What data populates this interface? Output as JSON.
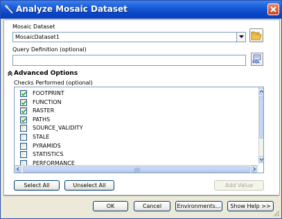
{
  "window": {
    "title": "Analyze Mosaic Dataset"
  },
  "mosaic": {
    "label": "Mosaic Dataset",
    "value": "MosaicDataset1"
  },
  "query": {
    "label": "Query Definition (optional)",
    "value": ""
  },
  "advanced": {
    "heading": "Advanced Options"
  },
  "checks": {
    "label": "Checks Performed (optional)",
    "items": [
      {
        "label": "FOOTPRINT",
        "checked": true
      },
      {
        "label": "FUNCTION",
        "checked": true
      },
      {
        "label": "RASTER",
        "checked": true
      },
      {
        "label": "PATHS",
        "checked": true
      },
      {
        "label": "SOURCE_VALIDITY",
        "checked": false
      },
      {
        "label": "STALE",
        "checked": false
      },
      {
        "label": "PYRAMIDS",
        "checked": false
      },
      {
        "label": "STATISTICS",
        "checked": false
      },
      {
        "label": "PERFORMANCE",
        "checked": false
      }
    ]
  },
  "list_buttons": {
    "select_all": "Select All",
    "unselect_all": "Unselect All",
    "add_value": "Add Value"
  },
  "footer": {
    "ok": "OK",
    "cancel": "Cancel",
    "environments": "Environments...",
    "show_help": "Show Help >>"
  },
  "sql_icon_text": "SQL"
}
